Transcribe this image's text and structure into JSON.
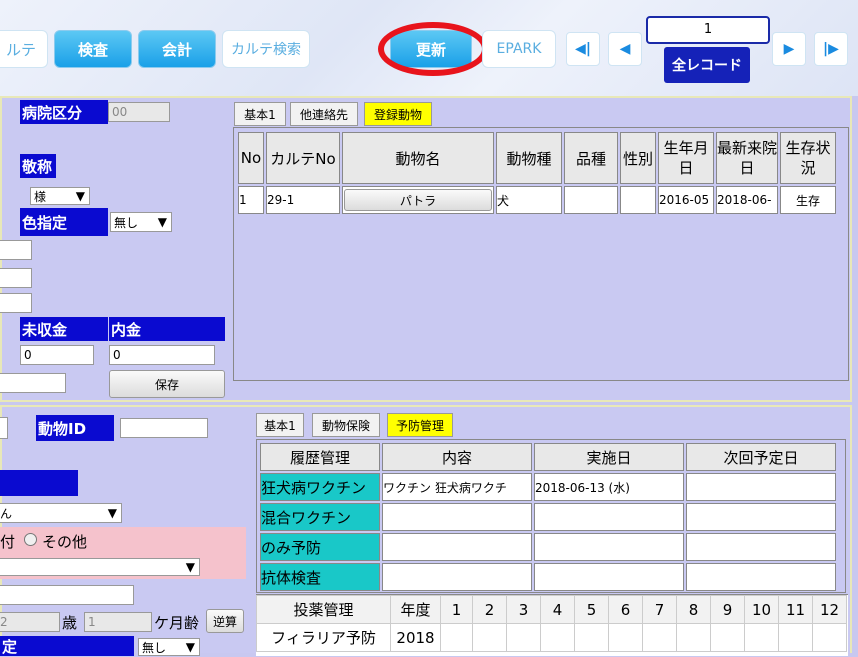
{
  "toolbar": {
    "karte_partial": "ルテ",
    "exam": "検査",
    "accounting": "会計",
    "karte_search": "カルテ検索",
    "update": "更新",
    "epark": "EPARK",
    "record_number": "1",
    "all_records": "全レコード",
    "nav_first": "◀|",
    "nav_prev": "◀",
    "nav_next": "▶",
    "nav_last": "|▶"
  },
  "owner": {
    "hospital_category_label": "病院区分",
    "hospital_category_value": "00",
    "honorific_label": "敬称",
    "honorific_value": "様",
    "color_label": "色指定",
    "color_value": "無し",
    "unpaid_label": "未収金",
    "unpaid_value": "0",
    "deposit_label": "内金",
    "deposit_value": "0",
    "save_button": "保存"
  },
  "owner_tabs": [
    "基本1",
    "他連絡先",
    "登録動物"
  ],
  "animals_table": {
    "headers": [
      "No",
      "カルテNo",
      "動物名",
      "動物種",
      "品種",
      "性別",
      "生年月日",
      "最新来院日",
      "生存状況"
    ],
    "rows": [
      {
        "no": "1",
        "karte_no": "29-1",
        "name": "パトラ",
        "species": "犬",
        "breed": "",
        "sex": "",
        "birth": "2016-05",
        "last_visit": "2018-06-",
        "status": "生存"
      }
    ]
  },
  "animal": {
    "animal_id_label": "動物ID",
    "animal_id_value": "",
    "select_partial": "ん",
    "radio_partial": "付",
    "radio_other": "その他",
    "age_value_partial": "2",
    "age_unit": "歳",
    "months_value": "1",
    "months_unit": "ケ月齢",
    "reverse_button": "逆算",
    "bottom_label_partial": "定",
    "bottom_select": "無し"
  },
  "animal_tabs": [
    "基本1",
    "動物保険",
    "予防管理"
  ],
  "prevention_table": {
    "headers": [
      "履歴管理",
      "内容",
      "実施日",
      "次回予定日"
    ],
    "rows": [
      {
        "name": "狂犬病ワクチン",
        "content": "ワクチン 狂犬病ワクチ",
        "date": "2018-06-13 (水)",
        "next": ""
      },
      {
        "name": "混合ワクチン",
        "content": "",
        "date": "",
        "next": ""
      },
      {
        "name": "のみ予防",
        "content": "",
        "date": "",
        "next": ""
      },
      {
        "name": "抗体検査",
        "content": "",
        "date": "",
        "next": ""
      }
    ]
  },
  "medication_table": {
    "headers": [
      "投薬管理",
      "年度",
      "1",
      "2",
      "3",
      "4",
      "5",
      "6",
      "7",
      "8",
      "9",
      "10",
      "11",
      "12"
    ],
    "rows": [
      {
        "name": "フィラリア予防",
        "year": "2018"
      }
    ]
  },
  "colors": {
    "accent_blue": "#0a0ad0",
    "highlight_yellow": "#ffff00",
    "cyan": "#19c8c8",
    "annotation_red": "#e8141c"
  }
}
